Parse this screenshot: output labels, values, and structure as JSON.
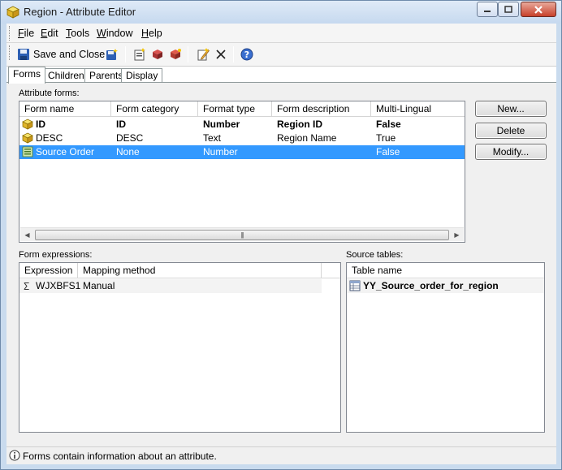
{
  "window": {
    "title": "Region - Attribute Editor"
  },
  "menu": {
    "items": [
      {
        "label": "File",
        "key": "F"
      },
      {
        "label": "Edit",
        "key": "E"
      },
      {
        "label": "Tools",
        "key": "T"
      },
      {
        "label": "Window",
        "key": "W"
      },
      {
        "label": "Help",
        "key": "H"
      }
    ]
  },
  "toolbar": {
    "save_close_label": "Save and Close",
    "icons": [
      "save-icon",
      "new-form-icon",
      "properties-icon",
      "edit-icon",
      "rename-icon",
      "delete-icon",
      "help-icon"
    ]
  },
  "tabs": [
    "Forms",
    "Children",
    "Parents",
    "Display"
  ],
  "attribute_forms": {
    "label": "Attribute forms:",
    "columns": [
      "Form name",
      "Form category",
      "Format type",
      "Form description",
      "Multi-Lingual"
    ],
    "rows": [
      {
        "name": "ID",
        "category": "ID",
        "format": "Number",
        "description": "Region ID",
        "multilingual": "False",
        "bold": true,
        "selected": false,
        "icon": "attribute-form-icon"
      },
      {
        "name": "DESC",
        "category": "DESC",
        "format": "Text",
        "description": "Region Name",
        "multilingual": "True",
        "bold": false,
        "selected": false,
        "icon": "attribute-form-icon"
      },
      {
        "name": "Source Order",
        "category": "None",
        "format": "Number",
        "description": "",
        "multilingual": "False",
        "bold": false,
        "selected": true,
        "icon": "sort-form-icon"
      }
    ]
  },
  "buttons": {
    "new": "New...",
    "delete": "Delete",
    "modify": "Modify..."
  },
  "form_expressions": {
    "label": "Form expressions:",
    "columns": [
      "Expression",
      "Mapping method"
    ],
    "rows": [
      {
        "expression": "WJXBFS1",
        "mapping": "Manual"
      }
    ]
  },
  "source_tables": {
    "label": "Source tables:",
    "columns": [
      "Table name"
    ],
    "rows": [
      {
        "name": "YY_Source_order_for_region"
      }
    ]
  },
  "status": {
    "text": "Forms contain information about an attribute."
  }
}
